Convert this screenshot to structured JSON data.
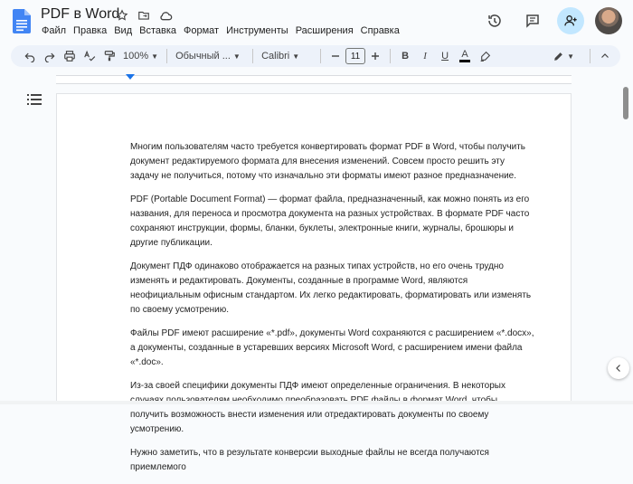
{
  "document": {
    "title": "PDF в Word"
  },
  "menu": [
    "Файл",
    "Правка",
    "Вид",
    "Вставка",
    "Формат",
    "Инструменты",
    "Расширения",
    "Справка"
  ],
  "toolbar": {
    "zoom": "100%",
    "style": "Обычный ...",
    "font": "Calibri",
    "font_size": "11",
    "bold": "B",
    "italic": "I",
    "underline": "U",
    "text_color": "A"
  },
  "paragraphs": [
    "Многим пользователям часто требуется конвертировать формат PDF в Word, чтобы получить документ редактируемого формата для внесения изменений. Совсем просто решить эту задачу не получиться, потому что изначально эти форматы имеют разное предназначение.",
    "PDF (Portable Document Format) — формат файла, предназначенный, как можно понять из его названия, для переноса и просмотра документа на разных устройствах. В формате PDF часто сохраняют инструкции, формы, бланки, буклеты, электронные книги, журналы, брошюры и другие публикации.",
    "Документ ПДФ одинаково отображается на разных типах устройств, но его очень трудно изменять и редактировать. Документы, созданные в программе Word, являются неофициальным офисным стандартом. Их легко редактировать, форматировать или изменять по своему усмотрению.",
    "Файлы PDF имеют расширение «*.pdf», документы Word сохраняются с расширением «*.docx», а документы, созданные в устаревших версиях Microsoft Word, с расширением имени файла «*.doc».",
    "Из-за своей специфики документы ПДФ имеют определенные ограничения. В некоторых случаях пользователям необходимо преобразовать PDF файлы в формат Word, чтобы получить возможность внести изменения или отредактировать документы по своему усмотрению.",
    "Нужно заметить, что в результате конверсии выходные файлы не всегда получаются приемлемого"
  ],
  "colors": {
    "accent": "#1a73e8",
    "share_bg": "#c2e7ff",
    "toolbar_bg": "#edf2fa",
    "docs_blue": "#4285f4"
  },
  "icons": [
    "docs-logo-icon",
    "star-icon",
    "move-folder-icon",
    "cloud-saved-icon",
    "history-icon",
    "comments-icon",
    "share-icon",
    "undo-icon",
    "redo-icon",
    "print-icon",
    "spellcheck-icon",
    "paint-format-icon",
    "highlight-icon",
    "editing-mode-icon",
    "chevron-up-icon",
    "outline-icon",
    "chevron-left-icon"
  ]
}
